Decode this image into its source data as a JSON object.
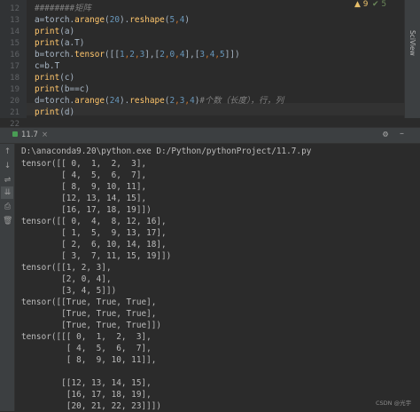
{
  "editor": {
    "line_numbers": [
      "12",
      "13",
      "14",
      "15",
      "16",
      "17",
      "18",
      "19",
      "20",
      "21",
      "22"
    ],
    "lines": [
      [
        {
          "t": "########矩阵",
          "c": "cm"
        }
      ],
      [
        {
          "t": "a=torch.",
          "c": ""
        },
        {
          "t": "arange",
          "c": "fn"
        },
        {
          "t": "(",
          "c": ""
        },
        {
          "t": "20",
          "c": "num"
        },
        {
          "t": ").",
          "c": ""
        },
        {
          "t": "reshape",
          "c": "fn"
        },
        {
          "t": "(",
          "c": ""
        },
        {
          "t": "5",
          "c": "num"
        },
        {
          "t": ",",
          "c": "kw"
        },
        {
          "t": "4",
          "c": "num"
        },
        {
          "t": ")",
          "c": ""
        }
      ],
      [
        {
          "t": "print",
          "c": "fn"
        },
        {
          "t": "(a)",
          "c": ""
        }
      ],
      [
        {
          "t": "print",
          "c": "fn"
        },
        {
          "t": "(a.T)",
          "c": ""
        }
      ],
      [
        {
          "t": "b=torch.",
          "c": ""
        },
        {
          "t": "tensor",
          "c": "fn"
        },
        {
          "t": "([[",
          "c": ""
        },
        {
          "t": "1",
          "c": "num"
        },
        {
          "t": ",",
          "c": "kw"
        },
        {
          "t": "2",
          "c": "num"
        },
        {
          "t": ",",
          "c": "kw"
        },
        {
          "t": "3",
          "c": "num"
        },
        {
          "t": "],[",
          "c": ""
        },
        {
          "t": "2",
          "c": "num"
        },
        {
          "t": ",",
          "c": "kw"
        },
        {
          "t": "0",
          "c": "num"
        },
        {
          "t": ",",
          "c": "kw"
        },
        {
          "t": "4",
          "c": "num"
        },
        {
          "t": "],[",
          "c": ""
        },
        {
          "t": "3",
          "c": "num"
        },
        {
          "t": ",",
          "c": "kw"
        },
        {
          "t": "4",
          "c": "num"
        },
        {
          "t": ",",
          "c": "kw"
        },
        {
          "t": "5",
          "c": "num"
        },
        {
          "t": "]])",
          "c": ""
        }
      ],
      [
        {
          "t": "c=b.T",
          "c": ""
        }
      ],
      [
        {
          "t": "print",
          "c": "fn"
        },
        {
          "t": "(c)",
          "c": ""
        }
      ],
      [
        {
          "t": "print",
          "c": "fn"
        },
        {
          "t": "(b==c)",
          "c": ""
        }
      ],
      [
        {
          "t": "d=torch.",
          "c": ""
        },
        {
          "t": "arange",
          "c": "fn"
        },
        {
          "t": "(",
          "c": ""
        },
        {
          "t": "24",
          "c": "num"
        },
        {
          "t": ").",
          "c": ""
        },
        {
          "t": "reshape",
          "c": "fn"
        },
        {
          "t": "(",
          "c": ""
        },
        {
          "t": "2",
          "c": "num"
        },
        {
          "t": ",",
          "c": "kw"
        },
        {
          "t": "3",
          "c": "num"
        },
        {
          "t": ",",
          "c": "kw"
        },
        {
          "t": "4",
          "c": "num"
        },
        {
          "t": ")",
          "c": ""
        },
        {
          "t": "#个数（长度），行，列",
          "c": "cm"
        }
      ],
      [
        {
          "t": "print",
          "c": "fn"
        },
        {
          "t": "(d)",
          "c": ""
        }
      ],
      [
        {
          "t": "",
          "c": ""
        }
      ]
    ],
    "sciview_label": "SciView",
    "warning_count": "▲ 9",
    "ok_count": "✔ 5"
  },
  "run": {
    "tab_label": "11.7",
    "tab_close": "×",
    "command": "D:\\anaconda9.20\\python.exe D:/Python/pythonProject/11.7.py",
    "output": [
      "tensor([[ 0,  1,  2,  3],",
      "        [ 4,  5,  6,  7],",
      "        [ 8,  9, 10, 11],",
      "        [12, 13, 14, 15],",
      "        [16, 17, 18, 19]])",
      "tensor([[ 0,  4,  8, 12, 16],",
      "        [ 1,  5,  9, 13, 17],",
      "        [ 2,  6, 10, 14, 18],",
      "        [ 3,  7, 11, 15, 19]])",
      "tensor([[1, 2, 3],",
      "        [2, 0, 4],",
      "        [3, 4, 5]])",
      "tensor([[True, True, True],",
      "        [True, True, True],",
      "        [True, True, True]])",
      "tensor([[[ 0,  1,  2,  3],",
      "         [ 4,  5,  6,  7],",
      "         [ 8,  9, 10, 11]],",
      "",
      "        [[12, 13, 14, 15],",
      "         [16, 17, 18, 19],",
      "         [20, 21, 22, 23]]])"
    ],
    "toolbar_icons": [
      "up-arrow-icon",
      "down-arrow-icon",
      "wrap-icon",
      "scroll-end-icon",
      "print-icon",
      "trash-icon"
    ]
  },
  "watermark": "CSDN @光宇"
}
